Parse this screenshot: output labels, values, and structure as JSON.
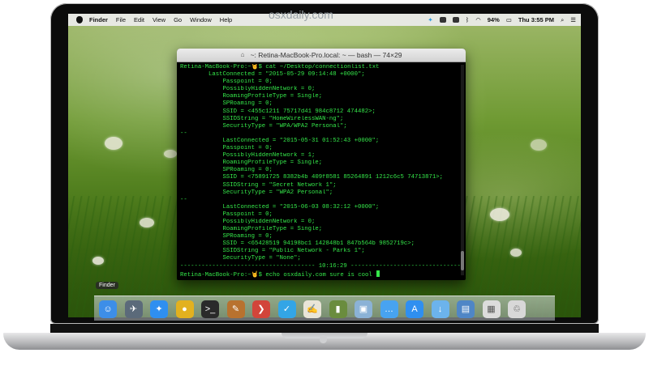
{
  "watermark": "osxdaily.com",
  "menubar": {
    "items": [
      "Finder",
      "File",
      "Edit",
      "View",
      "Go",
      "Window",
      "Help"
    ],
    "battery": "94%",
    "clock": "Thu 3:55 PM"
  },
  "terminal": {
    "title": "~: Retina-MacBook-Pro.local: ~ — bash — 74×29",
    "lines": [
      "Retina-MacBook-Pro:~🤘$ cat ~/Desktop/connectionlist.txt",
      "        LastConnected = \"2015-05-29 09:14:48 +0000\";",
      "            Passpoint = 0;",
      "            PossiblyHiddenNetwork = 0;",
      "            RoamingProfileType = Single;",
      "            SPRoaming = 0;",
      "            SSID = <455c1211 75717d41 984c8712 474482>;",
      "            SSIDString = \"HomeWirelessWAN-ng\";",
      "            SecurityType = \"WPA/WPA2 Personal\";",
      "--",
      "            LastConnected = \"2015-05-31 01:52:43 +0000\";",
      "            Passpoint = 0;",
      "            PossiblyHiddenNetwork = 1;",
      "            RoamingProfileType = Single;",
      "            SPRoaming = 0;",
      "            SSID = <75891725 8382b4b 409f8581 85264891 1212c6c5 74713871>;",
      "            SSIDString = \"Secret Network 1\";",
      "            SecurityType = \"WPA2 Personal\";",
      "--",
      "            LastConnected = \"2015-06-03 08:32:12 +0000\";",
      "            Passpoint = 0;",
      "            PossiblyHiddenNetwork = 0;",
      "            RoamingProfileType = Single;",
      "            SPRoaming = 0;",
      "            SSID = <65428519 94198bc1 142848b1 847b564b 9852719c>;",
      "            SSIDString = \"Public Network - Parks 1\";",
      "            SecurityType = \"None\";",
      "-------------------------------------- 10:16:29 -------------------------------",
      "Retina-MacBook-Pro:~🤘$ echo osxdaily.com sure is cool "
    ]
  },
  "dock": {
    "tooltip": "Finder",
    "icons": [
      {
        "name": "finder-icon",
        "color": "#3d8ee8",
        "glyph": "☺"
      },
      {
        "name": "launchpad-icon",
        "color": "#5b6a7a",
        "glyph": "✈"
      },
      {
        "name": "safari-icon",
        "color": "#2f8ff0",
        "glyph": "✦"
      },
      {
        "name": "chrome-icon",
        "color": "#e2b11f",
        "glyph": "●"
      },
      {
        "name": "terminal-icon",
        "color": "#2a2a2a",
        "glyph": ">_"
      },
      {
        "name": "pixelmator-icon",
        "color": "#b8722f",
        "glyph": "✎"
      },
      {
        "name": "tweetdeck-icon",
        "color": "#d2453a",
        "glyph": "❯"
      },
      {
        "name": "twitter-icon",
        "color": "#33a5e6",
        "glyph": "✓"
      },
      {
        "name": "textedit-icon",
        "color": "#e9e5d8",
        "glyph": "✍"
      },
      {
        "name": "books-icon",
        "color": "#6a8c3e",
        "glyph": "▮"
      },
      {
        "name": "preview-icon",
        "color": "#8bb2d6",
        "glyph": "▣"
      },
      {
        "name": "messages-icon",
        "color": "#48a3f0",
        "glyph": "…"
      },
      {
        "name": "app-store-icon",
        "color": "#2f8ff0",
        "glyph": "A"
      },
      {
        "name": "downloads-folder-icon",
        "color": "#6cb3ec",
        "glyph": "↓"
      },
      {
        "name": "applications-folder-icon",
        "color": "#4f86c6",
        "glyph": "▤"
      },
      {
        "name": "documents-icon",
        "color": "#dcdcdc",
        "glyph": "▦"
      },
      {
        "name": "trash-icon",
        "color": "#d8d8d8",
        "glyph": "♲"
      }
    ]
  }
}
